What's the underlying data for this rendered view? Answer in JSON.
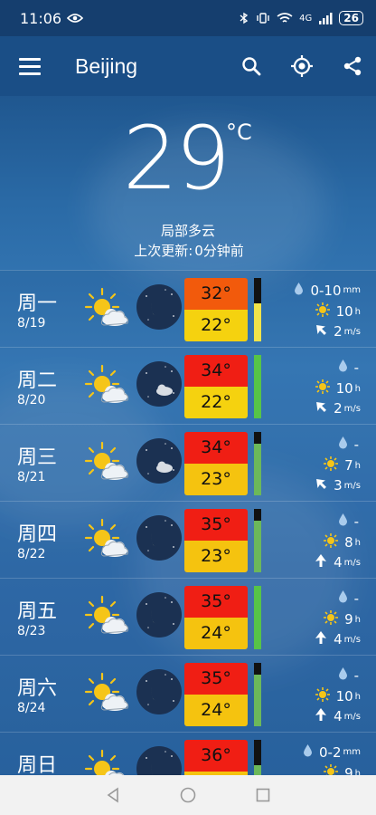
{
  "status": {
    "time": "11:06",
    "network": "4G",
    "battery": "26"
  },
  "header": {
    "city": "Beijing"
  },
  "current": {
    "temp": "29",
    "unit": "°C",
    "condition": "局部多云",
    "updated_label": "上次更新:",
    "updated_value": "0分钟前"
  },
  "days": [
    {
      "name": "周一",
      "date": "8/19",
      "high": "32°",
      "low": "22°",
      "high_color": "#f25a0c",
      "low_color": "#f5d20f",
      "rain": "0-10",
      "rain_unit": "mm",
      "sun": "10",
      "sun_unit": "h",
      "wind": "2",
      "wind_unit": "m/s",
      "wind_dir": "nw",
      "bar_fill": 0.6,
      "bar_color": "#f1e44a"
    },
    {
      "name": "周二",
      "date": "8/20",
      "high": "34°",
      "low": "22°",
      "high_color": "#f01e14",
      "low_color": "#f5d20f",
      "rain": "-",
      "rain_unit": "",
      "sun": "10",
      "sun_unit": "h",
      "wind": "2",
      "wind_unit": "m/s",
      "wind_dir": "nw",
      "bar_fill": 1.0,
      "bar_color": "#57c447"
    },
    {
      "name": "周三",
      "date": "8/21",
      "high": "34°",
      "low": "23°",
      "high_color": "#f01e14",
      "low_color": "#f5c30f",
      "rain": "-",
      "rain_unit": "",
      "sun": "7",
      "sun_unit": "h",
      "wind": "3",
      "wind_unit": "m/s",
      "wind_dir": "nw",
      "bar_fill": 0.82,
      "bar_color": "#6cb85a"
    },
    {
      "name": "周四",
      "date": "8/22",
      "high": "35°",
      "low": "23°",
      "high_color": "#f01e14",
      "low_color": "#f5c30f",
      "rain": "-",
      "rain_unit": "",
      "sun": "8",
      "sun_unit": "h",
      "wind": "4",
      "wind_unit": "m/s",
      "wind_dir": "n",
      "bar_fill": 0.82,
      "bar_color": "#6cb85a"
    },
    {
      "name": "周五",
      "date": "8/23",
      "high": "35°",
      "low": "24°",
      "high_color": "#f01e14",
      "low_color": "#f5c30f",
      "rain": "-",
      "rain_unit": "",
      "sun": "9",
      "sun_unit": "h",
      "wind": "4",
      "wind_unit": "m/s",
      "wind_dir": "n",
      "bar_fill": 1.0,
      "bar_color": "#57c447"
    },
    {
      "name": "周六",
      "date": "8/24",
      "high": "35°",
      "low": "24°",
      "high_color": "#f01e14",
      "low_color": "#f5c30f",
      "rain": "-",
      "rain_unit": "",
      "sun": "10",
      "sun_unit": "h",
      "wind": "4",
      "wind_unit": "m/s",
      "wind_dir": "n",
      "bar_fill": 0.82,
      "bar_color": "#6cb85a"
    },
    {
      "name": "周日",
      "date": "",
      "high": "36°",
      "low": "",
      "high_color": "#f01e14",
      "low_color": "#f5c30f",
      "rain": "0-2",
      "rain_unit": "mm",
      "sun": "9",
      "sun_unit": "h",
      "wind": "",
      "wind_unit": "",
      "wind_dir": "n",
      "bar_fill": 0.6,
      "bar_color": "#6cb85a"
    }
  ],
  "icons": {
    "menu": "menu-icon",
    "search": "search-icon",
    "location": "gps-icon",
    "share": "share-icon"
  }
}
